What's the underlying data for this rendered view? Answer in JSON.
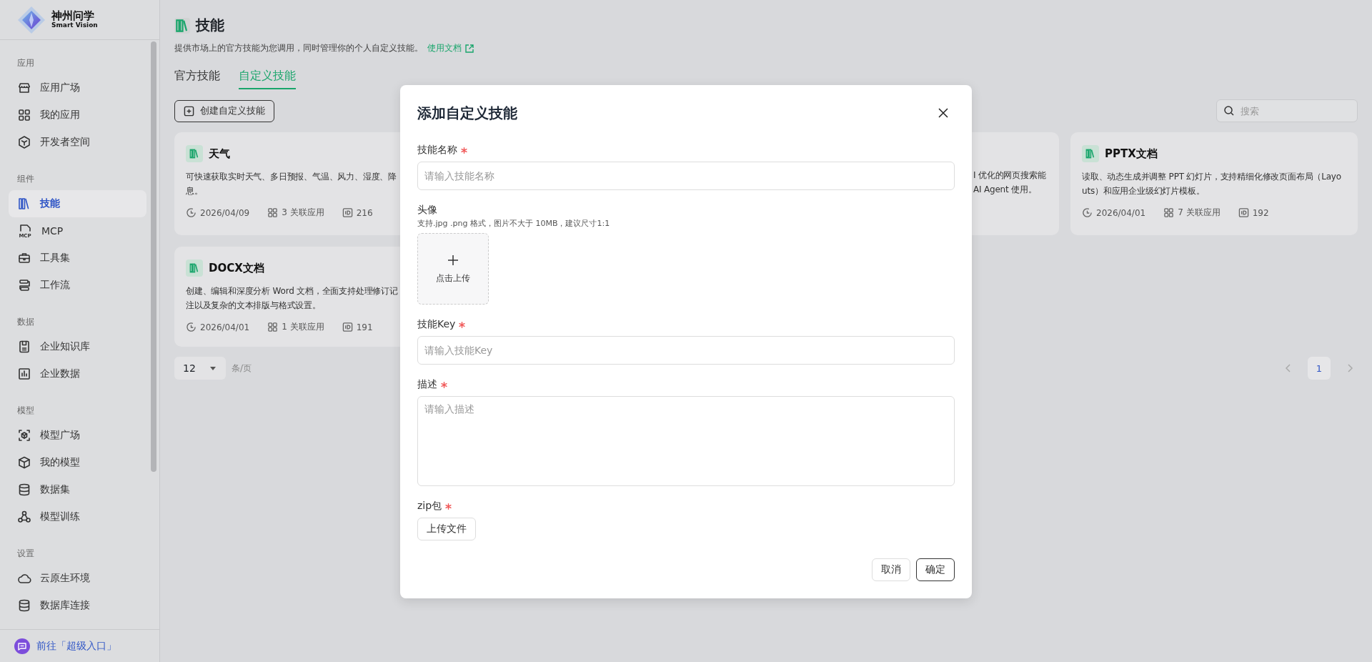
{
  "brand": {
    "name": "神州问学",
    "tagline": "Smart Vision"
  },
  "sidebar": {
    "sections": [
      {
        "title": "应用",
        "items": [
          {
            "label": "应用广场",
            "selected": false
          },
          {
            "label": "我的应用",
            "selected": false
          },
          {
            "label": "开发者空间",
            "selected": false
          }
        ]
      },
      {
        "title": "组件",
        "items": [
          {
            "label": "技能",
            "selected": true
          },
          {
            "label": "MCP",
            "selected": false,
            "icon_text": "MCP"
          },
          {
            "label": "工具集",
            "selected": false
          },
          {
            "label": "工作流",
            "selected": false
          }
        ]
      },
      {
        "title": "数据",
        "items": [
          {
            "label": "企业知识库",
            "selected": false
          },
          {
            "label": "企业数据",
            "selected": false
          }
        ]
      },
      {
        "title": "模型",
        "items": [
          {
            "label": "模型广场",
            "selected": false
          },
          {
            "label": "我的模型",
            "selected": false
          },
          {
            "label": "数据集",
            "selected": false
          },
          {
            "label": "模型训练",
            "selected": false
          }
        ]
      },
      {
        "title": "设置",
        "items": [
          {
            "label": "云原生环境",
            "selected": false
          },
          {
            "label": "数据库连接",
            "selected": false
          }
        ]
      }
    ],
    "footer_link": "前往「超级入口」"
  },
  "page": {
    "title": "技能",
    "subtitle": "提供市场上的官方技能为您调用，同时管理你的个人自定义技能。",
    "doc_link": "使用文档"
  },
  "tabs": [
    {
      "label": "官方技能",
      "selected": false
    },
    {
      "label": "自定义技能",
      "selected": true
    }
  ],
  "create_button": "创建自定义技能",
  "search": {
    "placeholder": "搜索"
  },
  "cards": [
    {
      "kind": "full",
      "title": "天气",
      "description_lines": [
        "可快速获取实时天气、多日预报、气温、风力、湿度、降",
        "息。"
      ],
      "date": "2026/04/09",
      "apps": "3 关联应用",
      "id": "216"
    },
    {
      "kind": "partial",
      "description_lines": [
        "I 优化的网页搜索能",
        "AI Agent 使用。"
      ]
    },
    {
      "kind": "full",
      "title": "PPTX文档",
      "description_lines": [
        "读取、动态生成并调整 PPT 幻灯片，支持精细化修改页面布局（Layo",
        "uts）和应用企业级幻灯片模板。"
      ],
      "date": "2026/04/01",
      "apps": "7 关联应用",
      "id": "192"
    },
    {
      "kind": "full",
      "title": "DOCX文档",
      "description_lines": [
        "创建、编辑和深度分析 Word 文档，全面支持处理修订记",
        "注以及复杂的文本排版与格式设置。"
      ],
      "date": "2026/04/01",
      "apps": "1 关联应用",
      "id": "191"
    }
  ],
  "pagination": {
    "page_size": "12",
    "unit": "条/页",
    "pages": [
      {
        "label": "1",
        "selected": true
      }
    ]
  },
  "dialog": {
    "title": "添加自定义技能",
    "fields": [
      {
        "kind": "text",
        "label": "技能名称",
        "required": true,
        "placeholder": "请输入技能名称"
      },
      {
        "kind": "image_upload",
        "label": "头像",
        "required": false,
        "hint": "支持.jpg .png 格式，图片不大于 10MB，建议尺寸1:1",
        "button": "点击上传"
      },
      {
        "kind": "text",
        "label": "技能Key",
        "required": true,
        "placeholder": "请输入技能Key"
      },
      {
        "kind": "textarea",
        "label": "描述",
        "required": true,
        "placeholder": "请输入描述"
      },
      {
        "kind": "file",
        "label": "zip包",
        "required": true,
        "button": "上传文件"
      }
    ],
    "buttons": [
      {
        "label": "取消",
        "kind": "default"
      },
      {
        "label": "确定",
        "kind": "primary"
      }
    ]
  }
}
